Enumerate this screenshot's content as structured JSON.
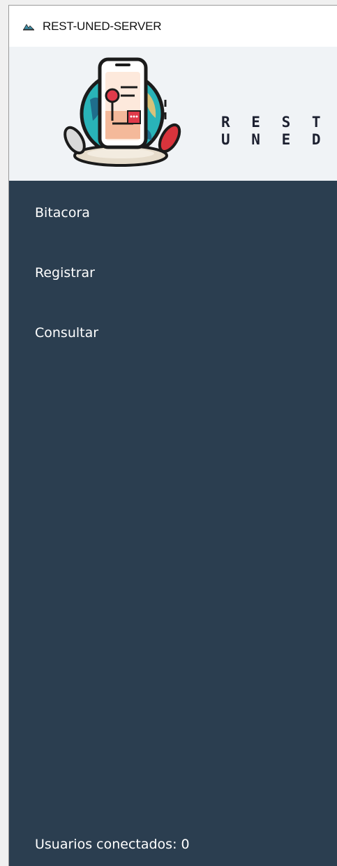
{
  "window": {
    "title": "REST-UNED-SERVER"
  },
  "logo": {
    "word_line1": "R E S T",
    "word_line2": "U N E D"
  },
  "sidebar": {
    "items": [
      {
        "label": "Bitacora"
      },
      {
        "label": "Registrar"
      },
      {
        "label": "Consultar"
      }
    ]
  },
  "status": {
    "connected_users_text": "Usuarios conectados: 0"
  },
  "colors": {
    "sidebar_bg": "#2b3e50",
    "logo_bg": "#f0f3f6",
    "text_light": "#ffffff"
  }
}
